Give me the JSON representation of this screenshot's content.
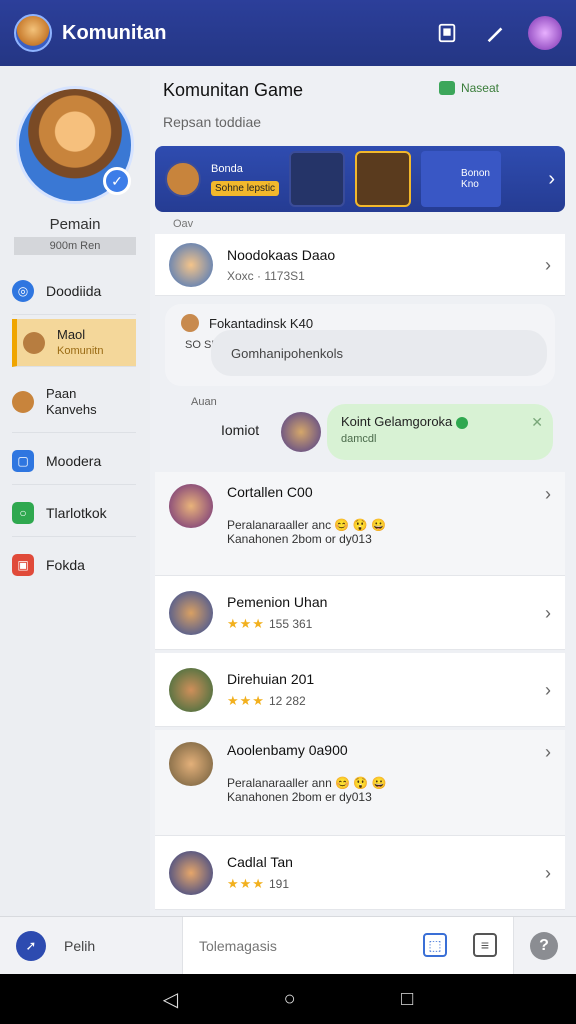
{
  "header": {
    "title": "Komunitan"
  },
  "sidebar": {
    "profile": {
      "name": "Pemain",
      "subtitle": "900m Ren"
    },
    "items": [
      {
        "label": "Doodiida"
      },
      {
        "label": "Maol",
        "sublabel": "Komunitn"
      },
      {
        "label": "Paan Kanvehs"
      },
      {
        "label": "Moodera"
      },
      {
        "label": "Tlarlotkok"
      },
      {
        "label": "Fokda"
      }
    ]
  },
  "main": {
    "title": "Komunitan Game",
    "subtitle": "Repsan toddiae",
    "status": "Naseat",
    "banner": {
      "label": "Bonda",
      "tag": "Sohne lepstic",
      "right_label": "Bonon",
      "right_sub": "Kno"
    },
    "tiny_label": "Oav",
    "rows": [
      {
        "title": "Noodokaas Daao",
        "sub": "Xoxc · 1173S1"
      },
      {
        "title": "Cortallen C00",
        "line1": "Peralanaraaller anc",
        "line2": "Kanahonen 2bom or dy013"
      },
      {
        "title": "Pemenion Uhan",
        "stars": "★★★",
        "count": "155 361"
      },
      {
        "title": "Direhuian 201",
        "stars": "★★★",
        "count": "12 282"
      },
      {
        "title": "Aoolenbamy 0a900",
        "line1": "Peralanaraaller ann",
        "line2": "Kanahonen 2bom er dy013"
      },
      {
        "title": "Cadlal Tan",
        "stars": "★★★",
        "count": "191"
      }
    ],
    "thread": {
      "who": "Fokantadinsk K40",
      "side": "SO\nSI",
      "placeholder": "Gomhanipohenkols"
    },
    "message": {
      "aux": "Auan",
      "label": "Iomiot",
      "title": "Koint Gelamgoroka",
      "sub": "damcdl"
    }
  },
  "bottom": {
    "pick_label": "Pelih",
    "input_placeholder": "Tolemagasis",
    "help": "?"
  },
  "colors": {
    "primary": "#2c3f9a",
    "accent": "#f0a500",
    "success": "#2fa84f"
  },
  "icons": [
    "app-logo-icon",
    "clipboard-icon",
    "pencil-icon",
    "profile-icon",
    "chevron-right-icon",
    "verified-icon",
    "rocket-icon",
    "image-icon",
    "clipboard-icon",
    "help-icon"
  ]
}
